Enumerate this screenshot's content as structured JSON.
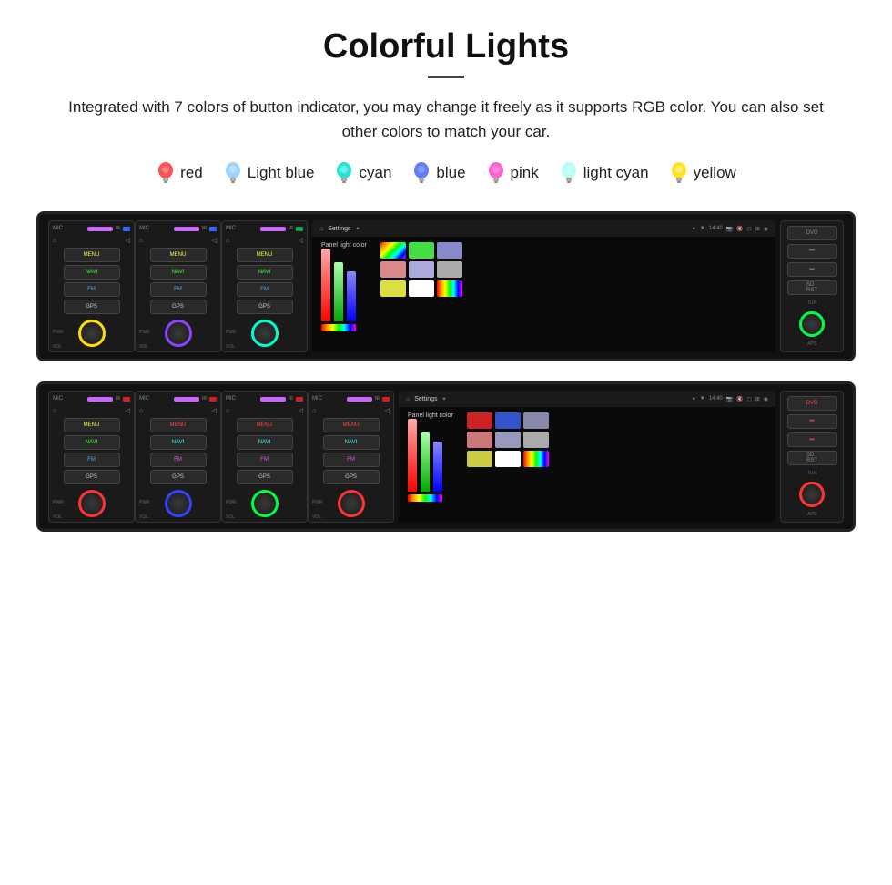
{
  "header": {
    "title": "Colorful Lights",
    "description": "Integrated with 7 colors of button indicator, you may change it freely as it supports RGB color. You can also set other colors to match your car."
  },
  "colors": [
    {
      "name": "red",
      "color": "#ff3333",
      "id": "red"
    },
    {
      "name": "Light blue",
      "color": "#88ccff",
      "id": "light-blue"
    },
    {
      "name": "cyan",
      "color": "#00ddcc",
      "id": "cyan"
    },
    {
      "name": "blue",
      "color": "#4466ff",
      "id": "blue"
    },
    {
      "name": "pink",
      "color": "#ff44cc",
      "id": "pink"
    },
    {
      "name": "light cyan",
      "color": "#aaffee",
      "id": "light-cyan"
    },
    {
      "name": "yellow",
      "color": "#ffdd00",
      "id": "yellow"
    }
  ],
  "units": {
    "top": {
      "panels": [
        "yellow",
        "purple",
        "cyan"
      ],
      "screen_label": "Panel light color"
    },
    "bottom": {
      "panels": [
        "red",
        "blue",
        "green"
      ],
      "screen_label": "Panel light color"
    }
  }
}
